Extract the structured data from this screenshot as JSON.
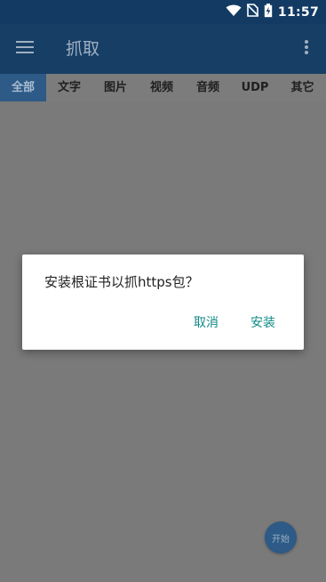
{
  "status_bar": {
    "time": "11:57",
    "icons": [
      "wifi-icon",
      "no-sim-icon",
      "battery-charging-icon"
    ]
  },
  "app_bar": {
    "title": "抓取",
    "menu_icon": "hamburger-menu-icon",
    "overflow_icon": "more-vert-icon"
  },
  "tabs": [
    {
      "label": "全部",
      "active": true
    },
    {
      "label": "文字",
      "active": false
    },
    {
      "label": "图片",
      "active": false
    },
    {
      "label": "视频",
      "active": false
    },
    {
      "label": "音频",
      "active": false
    },
    {
      "label": "UDP",
      "active": false
    },
    {
      "label": "其它",
      "active": false
    }
  ],
  "dialog": {
    "message": "安装根证书以抓https包？",
    "cancel_label": "取消",
    "confirm_label": "安装"
  },
  "fab": {
    "label": "开始"
  },
  "colors": {
    "primary_dark": "#123a63",
    "primary": "#173e65",
    "accent_text": "#0f8a86",
    "scrim": "#7a7a7a"
  }
}
